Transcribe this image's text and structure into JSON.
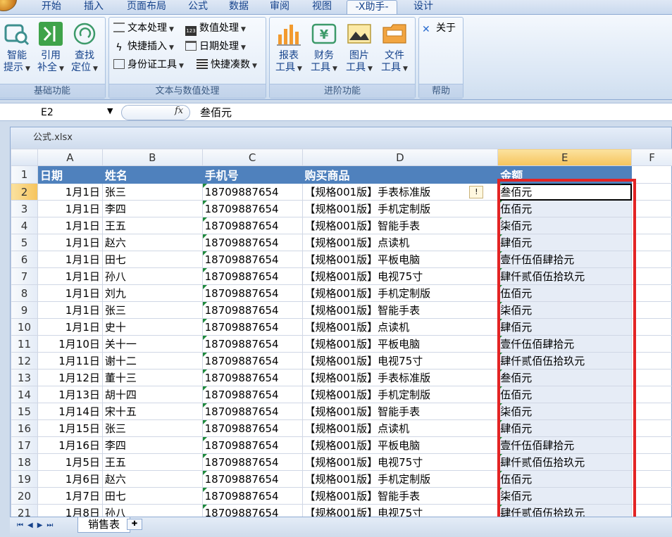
{
  "tabs": [
    "开始",
    "插入",
    "页面布局",
    "公式",
    "数据",
    "审阅",
    "视图",
    "-X助手-",
    "设计"
  ],
  "ribbon": {
    "groups": [
      {
        "label": "基础功能",
        "buttons": [
          [
            "智能",
            "提示"
          ],
          [
            "引用",
            "补全"
          ],
          [
            "查找",
            "定位"
          ]
        ]
      },
      {
        "label": "文本与数值处理",
        "items": [
          "文本处理",
          "数值处理",
          "快捷插入",
          "日期处理",
          "身份证工具",
          "快捷凑数"
        ]
      },
      {
        "label": "进阶功能",
        "buttons": [
          [
            "报表",
            "工具"
          ],
          [
            "财务",
            "工具"
          ],
          [
            "图片",
            "工具"
          ],
          [
            "文件",
            "工具"
          ]
        ]
      },
      {
        "label": "帮助",
        "items": [
          "关于"
        ]
      }
    ]
  },
  "formula_bar": {
    "cell_ref": "E2",
    "fx": "fx",
    "value": "叁佰元"
  },
  "workbook": {
    "title": "公式.xlsx"
  },
  "columns": [
    "A",
    "B",
    "C",
    "D",
    "E",
    "F"
  ],
  "header_row": [
    "日期",
    "姓名",
    "手机号",
    "购买商品",
    "金额"
  ],
  "rows": [
    [
      "1月1日",
      "张三",
      "18709887654",
      "【规格001版】手表标准版",
      "叁佰元"
    ],
    [
      "1月1日",
      "李四",
      "18709887654",
      "【规格001版】手机定制版",
      "伍佰元"
    ],
    [
      "1月1日",
      "王五",
      "18709887654",
      "【规格001版】智能手表",
      "柒佰元"
    ],
    [
      "1月1日",
      "赵六",
      "18709887654",
      "【规格001版】点读机",
      "肆佰元"
    ],
    [
      "1月1日",
      "田七",
      "18709887654",
      "【规格001版】平板电脑",
      "壹仟伍佰肆拾元"
    ],
    [
      "1月1日",
      "孙八",
      "18709887654",
      "【规格001版】电视75寸",
      "肆仟贰佰伍拾玖元"
    ],
    [
      "1月1日",
      "刘九",
      "18709887654",
      "【规格001版】手机定制版",
      "伍佰元"
    ],
    [
      "1月1日",
      "张三",
      "18709887654",
      "【规格001版】智能手表",
      "柒佰元"
    ],
    [
      "1月1日",
      "史十",
      "18709887654",
      "【规格001版】点读机",
      "肆佰元"
    ],
    [
      "1月10日",
      "关十一",
      "18709887654",
      "【规格001版】平板电脑",
      "壹仟伍佰肆拾元"
    ],
    [
      "1月11日",
      "谢十二",
      "18709887654",
      "【规格001版】电视75寸",
      "肆仟贰佰伍拾玖元"
    ],
    [
      "1月12日",
      "董十三",
      "18709887654",
      "【规格001版】手表标准版",
      "叁佰元"
    ],
    [
      "1月13日",
      "胡十四",
      "18709887654",
      "【规格001版】手机定制版",
      "伍佰元"
    ],
    [
      "1月14日",
      "宋十五",
      "18709887654",
      "【规格001版】智能手表",
      "柒佰元"
    ],
    [
      "1月15日",
      "张三",
      "18709887654",
      "【规格001版】点读机",
      "肆佰元"
    ],
    [
      "1月16日",
      "李四",
      "18709887654",
      "【规格001版】平板电脑",
      "壹仟伍佰肆拾元"
    ],
    [
      "1月5日",
      "王五",
      "18709887654",
      "【规格001版】电视75寸",
      "肆仟贰佰伍拾玖元"
    ],
    [
      "1月6日",
      "赵六",
      "18709887654",
      "【规格001版】手机定制版",
      "伍佰元"
    ],
    [
      "1月7日",
      "田七",
      "18709887654",
      "【规格001版】智能手表",
      "柒佰元"
    ],
    [
      "1月8日",
      "孙八",
      "18709887654",
      "【规格001版】电视75寸",
      "肆仟贰佰伍拾玖元"
    ]
  ],
  "sheet_tabs": [
    "销售表"
  ]
}
